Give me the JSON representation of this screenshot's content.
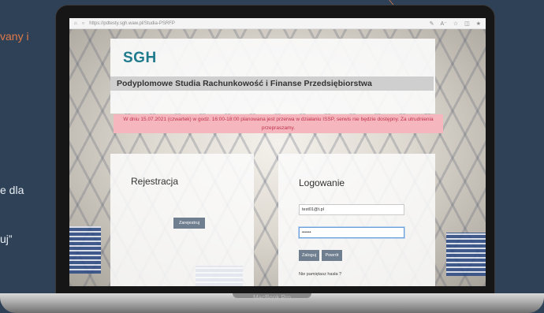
{
  "slide": {
    "fragment_top": "vany i",
    "fragment_mid": "e dla",
    "fragment_bottom": "uj”"
  },
  "laptop": {
    "model": "MacBook Pro"
  },
  "browser": {
    "url": "https://pdtesty.sgh.waw.pl/Studia-PSRFP",
    "icons": [
      "home-icon",
      "lock-icon",
      "star-icon",
      "reader-icon",
      "favorites-icon",
      "collections-icon"
    ]
  },
  "page": {
    "logo": "SGH",
    "title": "Podyplomowe Studia Rachunkowość i Finanse Przedsiębiorstwa",
    "alert": "W dniu 15.07.2021 (czwartek) w godz. 16:00-18:00 planowana jest przerwa w działaniu ISSP, serwis nie będzie dostępny. Za utrudnienia przepraszamy.",
    "registration": {
      "title": "Rejestracja",
      "button": "Zarejestruj"
    },
    "login": {
      "title": "Logowanie",
      "email_value": "test01@t.pl",
      "password_value": "••••••",
      "login_button": "Zaloguj",
      "back_button": "Powrót",
      "forgot": "Nie pamiętasz hasła ?"
    }
  },
  "colors": {
    "slide_bg": "#2f4156",
    "accent_orange": "#e07a4a",
    "logo_teal": "#1f7a8c",
    "alert_bg": "#f5b6be",
    "alert_text": "#c0324a",
    "button_bg": "#6f7f8f"
  }
}
